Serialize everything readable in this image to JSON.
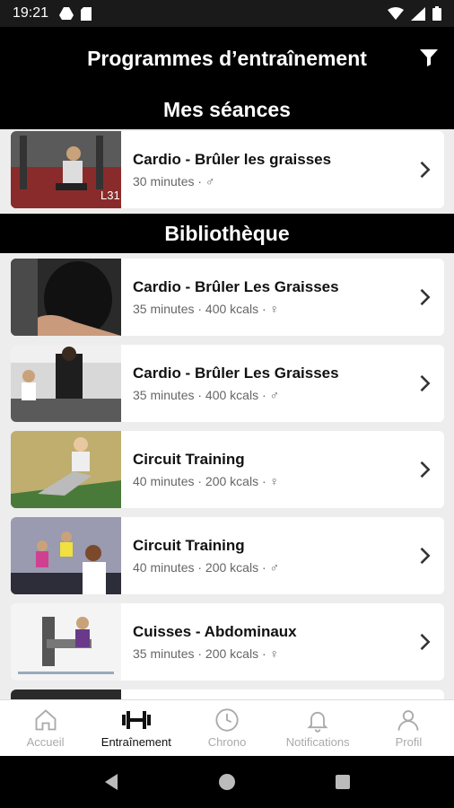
{
  "status_bar": {
    "time": "19:21"
  },
  "header": {
    "title": "Programmes d’entraînement"
  },
  "sections": {
    "mine": "Mes séances",
    "library": "Bibliothèque"
  },
  "my_sessions": [
    {
      "name": "Cardio - Brûler les graisses",
      "meta": "30 minutes · ♂"
    }
  ],
  "library": [
    {
      "name": "Cardio - Brûler Les Graisses",
      "meta": "35 minutes · 400 kcals · ♀"
    },
    {
      "name": "Cardio - Brûler Les Graisses",
      "meta": "35 minutes · 400 kcals · ♂"
    },
    {
      "name": "Circuit Training",
      "meta": "40 minutes · 200 kcals · ♀"
    },
    {
      "name": "Circuit Training",
      "meta": "40 minutes · 200 kcals · ♂"
    },
    {
      "name": "Cuisses - Abdominaux",
      "meta": "35 minutes · 200 kcals · ♀"
    }
  ],
  "bottom_nav": [
    {
      "label": "Accueil",
      "icon": "home-icon"
    },
    {
      "label": "Entraînement",
      "icon": "dumbbell-icon",
      "active": true
    },
    {
      "label": "Chrono",
      "icon": "clock-icon"
    },
    {
      "label": "Notifications",
      "icon": "bell-icon"
    },
    {
      "label": "Profil",
      "icon": "user-icon"
    }
  ]
}
